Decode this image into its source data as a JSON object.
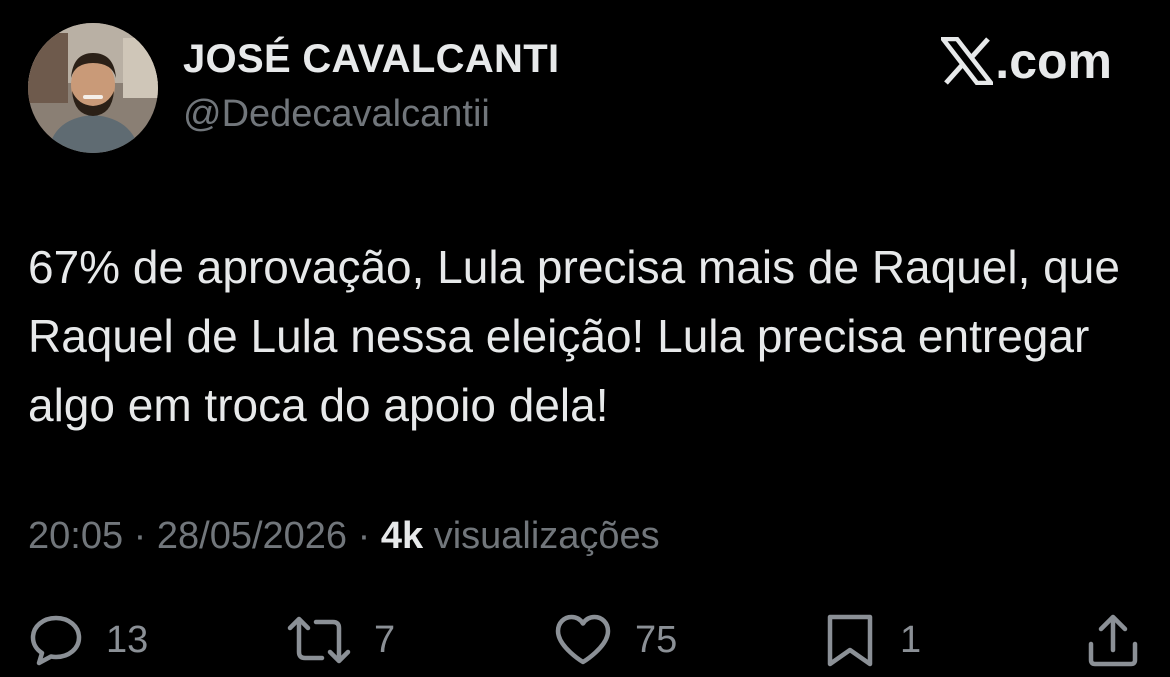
{
  "author": {
    "name": "JOSÉ CAVALCANTI",
    "handle": "@Dedecavalcantii"
  },
  "brand": {
    "icon": "x-logo-icon",
    "domain": ".com"
  },
  "tweet": {
    "text": "67% de aprovação, Lula precisa mais de Raquel, que Raquel de Lula nessa eleição! Lula precisa entregar algo em troca do apoio dela!",
    "time": "20:05",
    "date": "28/05/2026",
    "separator": "·",
    "views_count": "4k",
    "views_label": "visualizações"
  },
  "actions": {
    "reply_count": "13",
    "retweet_count": "7",
    "like_count": "75",
    "bookmark_count": "1"
  },
  "colors": {
    "background": "#000000",
    "primary_text": "#e7e9ea",
    "secondary_text": "#71767b"
  }
}
